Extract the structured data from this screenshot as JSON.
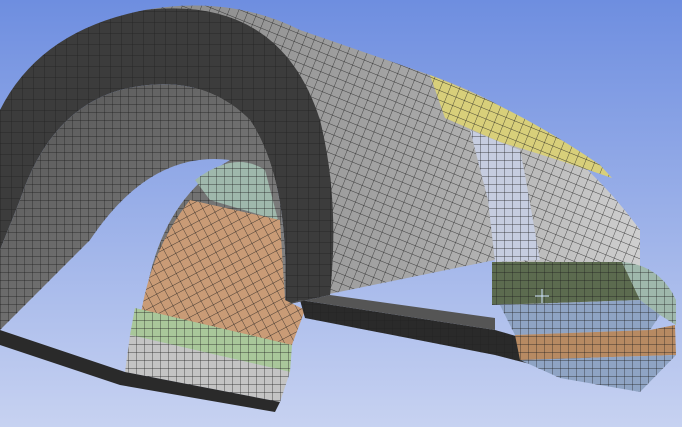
{
  "viewport": {
    "background_top": "#6e8ee0",
    "background_bottom": "#c7d2f1",
    "mesh_line_color": "#1c1c1c"
  },
  "colors": {
    "outer_shell": "#9b9b9b",
    "outer_shell_light": "#c4c4c4",
    "front_face": "#3c3c3c",
    "inner_bore": "#707070",
    "inner_bore_dark": "#4a4a4a",
    "bottom_strip": "#2a2a2a",
    "yellow_patch": "#d8cf7a",
    "blue_band": "#c6cde0",
    "tan_region": "#c99b76",
    "green_band": "#a9c79a",
    "teal_region": "#9fb8ac",
    "dark_green_block": "#5c6b4f",
    "small_blue": "#8fa4c4",
    "small_tan": "#b78a62"
  },
  "icons": {
    "cursor": "crosshair-cursor-icon"
  }
}
